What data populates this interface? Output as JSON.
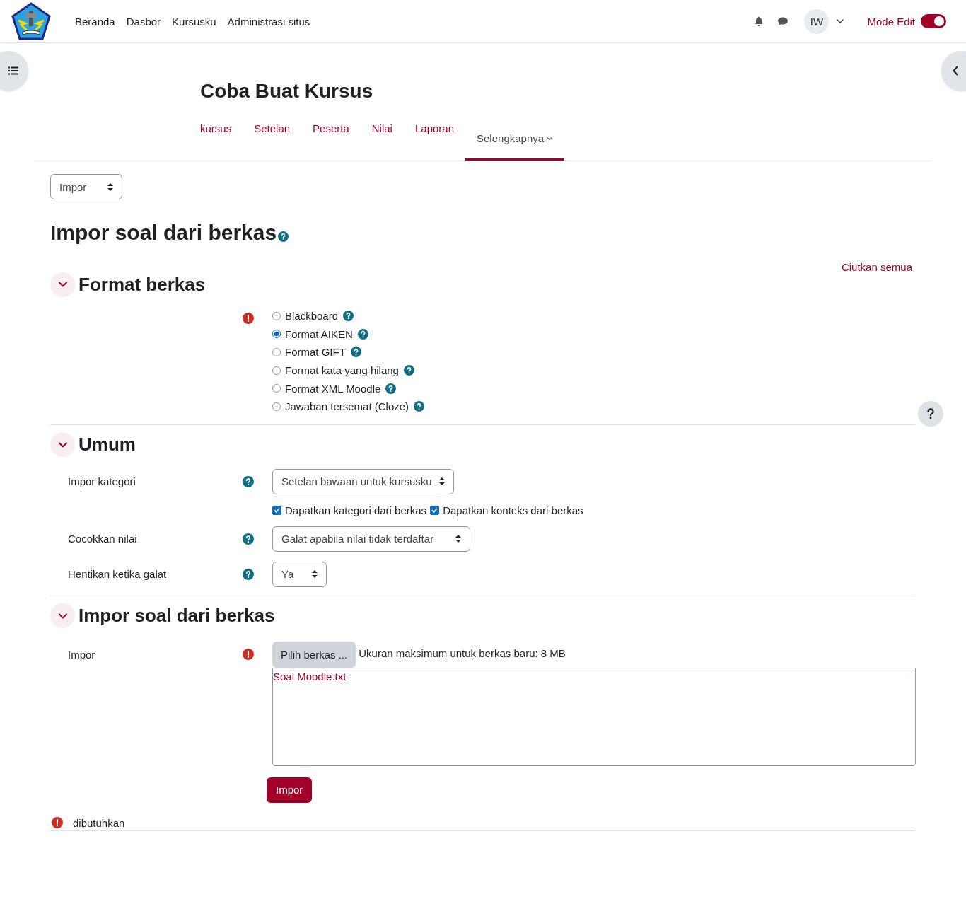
{
  "header": {
    "nav": [
      "Beranda",
      "Dasbor",
      "Kursusku",
      "Administrasi situs"
    ],
    "avatar": "IW",
    "edit_mode": {
      "label": "Mode Edit",
      "on": true
    }
  },
  "course": {
    "title": "Coba Buat Kursus",
    "tabs": [
      {
        "label": "kursus",
        "selected": false,
        "dropdown": false
      },
      {
        "label": "Setelan",
        "selected": false,
        "dropdown": false
      },
      {
        "label": "Peserta",
        "selected": false,
        "dropdown": false
      },
      {
        "label": "Nilai",
        "selected": false,
        "dropdown": false
      },
      {
        "label": "Laporan",
        "selected": false,
        "dropdown": false
      },
      {
        "label": "Selengkapnya",
        "selected": true,
        "dropdown": true
      }
    ]
  },
  "action_select": "Impor",
  "page_title": "Impor soal dari berkas",
  "collapse_all": "Ciutkan semua",
  "sections": [
    {
      "title": "Format berkas",
      "expanded": true,
      "fields": [
        {
          "kind": "radios",
          "required": true,
          "options": [
            {
              "label": "Blackboard",
              "selected": false
            },
            {
              "label": "Format AIKEN",
              "selected": true
            },
            {
              "label": "Format GIFT",
              "selected": false
            },
            {
              "label": "Format kata yang hilang",
              "selected": false
            },
            {
              "label": "Format XML Moodle",
              "selected": false
            },
            {
              "label": "Jawaban tersemat (Cloze)",
              "selected": false
            }
          ]
        }
      ]
    },
    {
      "title": "Umum",
      "expanded": true,
      "fields": [
        {
          "kind": "select",
          "label": "Impor kategori",
          "required": false,
          "value": "Setelan bawaan untuk kursusku"
        },
        {
          "kind": "checkboxes",
          "options": [
            {
              "label": "Dapatkan kategori dari berkas",
              "checked": true
            },
            {
              "label": "Dapatkan konteks dari berkas",
              "checked": true
            }
          ]
        },
        {
          "kind": "select",
          "label": "Cocokkan nilai",
          "required": false,
          "value": "Galat apabila nilai tidak terdaftar"
        },
        {
          "kind": "select",
          "label": "Hentikan ketika galat",
          "required": false,
          "value": "Ya"
        }
      ]
    },
    {
      "title": "Impor soal dari berkas",
      "expanded": true,
      "fields": [
        {
          "kind": "file",
          "label": "Impor",
          "required": true,
          "button": "Pilih berkas ...",
          "note": "Ukuran maksimum untuk berkas baru: 8 MB",
          "files": [
            "Soal Moodle.txt"
          ]
        }
      ]
    }
  ],
  "submit": "Impor",
  "required_note": "dibutuhkan"
}
